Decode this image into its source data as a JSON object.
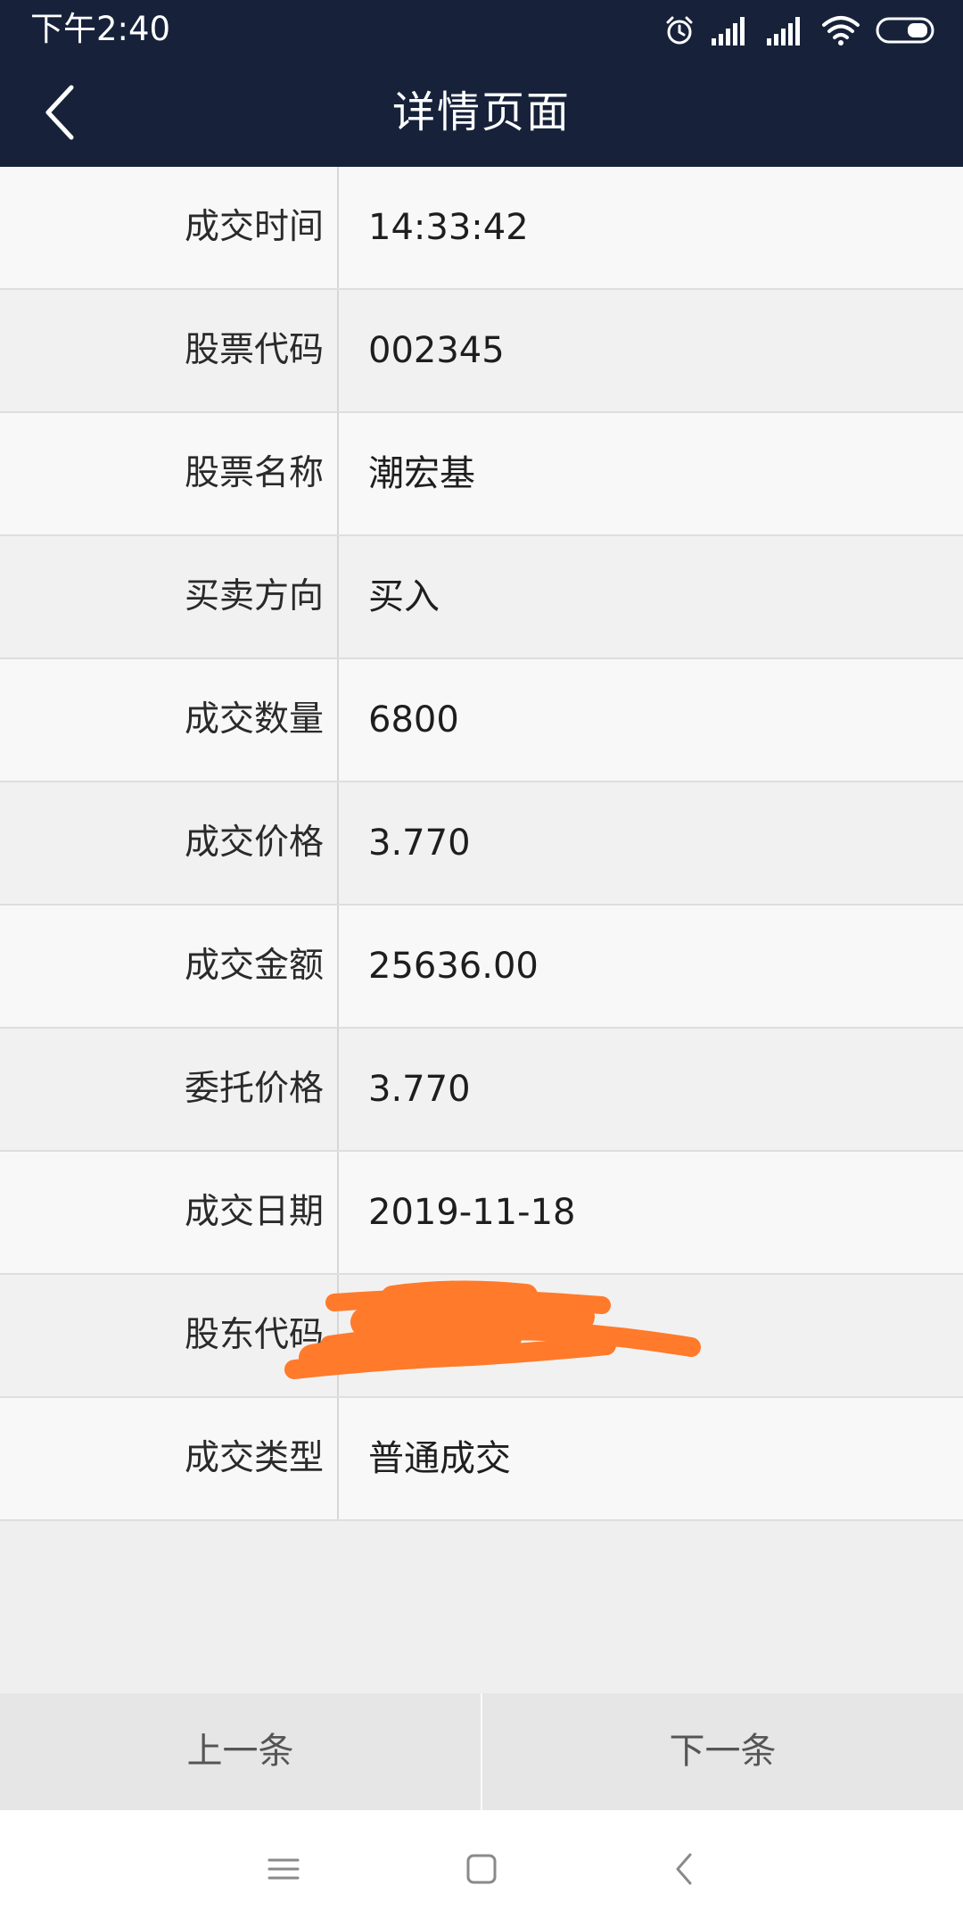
{
  "status_bar": {
    "time": "下午2:40",
    "icons": [
      "alarm-icon",
      "signal-icon",
      "signal-icon",
      "wifi-icon",
      "battery-icon"
    ]
  },
  "header": {
    "title": "详情页面",
    "back_icon": "chevron-left-icon"
  },
  "details": [
    {
      "label": "成交时间",
      "value": "14:33:42"
    },
    {
      "label": "股票代码",
      "value": "002345"
    },
    {
      "label": "股票名称",
      "value": "潮宏基"
    },
    {
      "label": "买卖方向",
      "value": "买入"
    },
    {
      "label": "成交数量",
      "value": "6800"
    },
    {
      "label": "成交价格",
      "value": "3.770"
    },
    {
      "label": "成交金额",
      "value": "25636.00"
    },
    {
      "label": "委托价格",
      "value": "3.770"
    },
    {
      "label": "成交日期",
      "value": "2019-11-18"
    },
    {
      "label": "股东代码",
      "value": ""
    },
    {
      "label": "成交类型",
      "value": "普通成交"
    }
  ],
  "footer": {
    "prev_label": "上一条",
    "next_label": "下一条"
  },
  "colors": {
    "header_bg": "#17223a",
    "redaction": "#ff7a2a"
  }
}
